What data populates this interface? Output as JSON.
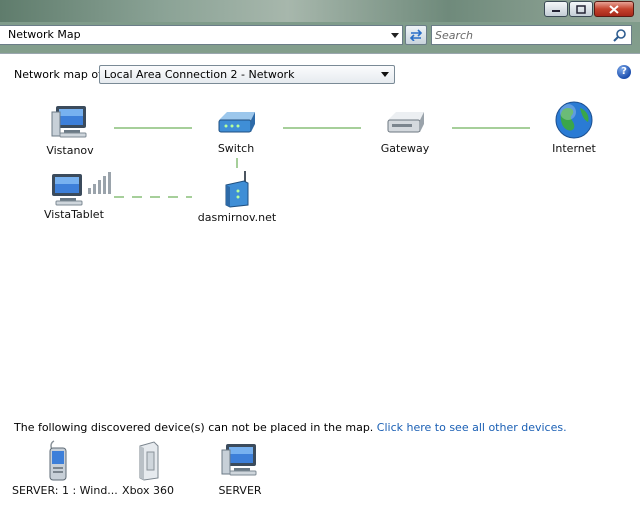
{
  "window": {
    "title": "Network Map"
  },
  "search": {
    "placeholder": "Search"
  },
  "header": {
    "map_of_label": "Network map of",
    "connection_selected": "Local Area Connection 2 - Network",
    "help_label": "?"
  },
  "map": {
    "nodes": {
      "vistanov": "Vistanov",
      "switch": "Switch",
      "gateway": "Gateway",
      "internet": "Internet",
      "vistatablet": "VistaTablet",
      "dasmirnov": "dasmirnov.net"
    }
  },
  "discovered": {
    "notice_text": "The following discovered device(s) can not be placed in the map.",
    "link_text": "Click here to see all other devices.",
    "devices": [
      "SERVER: 1 : Wind...",
      "Xbox 360",
      "SERVER"
    ]
  }
}
